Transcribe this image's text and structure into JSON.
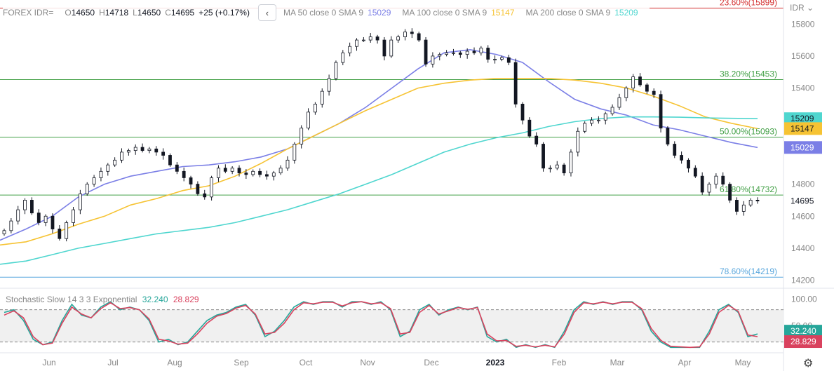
{
  "legend": {
    "symbol": "FOREX IDR=",
    "open_label": "O",
    "open": "14650",
    "high_label": "H",
    "high": "14718",
    "low_label": "L",
    "low": "14650",
    "close_label": "C",
    "close": "14695",
    "change": "+25 (+0.17%)",
    "ma50_label": "MA 50 close 0 SMA 9",
    "ma50_value": "15029",
    "ma100_label": "MA 100 close 0 SMA 9",
    "ma100_value": "15147",
    "ma200_label": "MA 200 close 0 SMA 9",
    "ma200_value": "15209"
  },
  "currency_label": "IDR",
  "stochastic": {
    "label": "Stochastic Slow 14 3 3 Exponential",
    "k_value": "32.240",
    "d_value": "28.829"
  },
  "colors": {
    "ma50": "#7b7fe6",
    "ma100": "#f6c333",
    "ma200": "#4fd6cf",
    "stoch_k": "#26a69a",
    "stoch_d": "#d9425e",
    "fib_red": "#d32f2f",
    "fib_green": "#43a047",
    "fib_blue": "#5aa7dd"
  },
  "chart_data": [
    {
      "type": "candlestick",
      "title": "FOREX IDR=",
      "y_unit": "IDR",
      "ylim": [
        14150,
        15950
      ],
      "y_ticks": [
        14200,
        14400,
        14600,
        14800,
        15400,
        15600,
        15800
      ],
      "x_ticks": [
        "Jun",
        "Jul",
        "Aug",
        "Sep",
        "Oct",
        "Nov",
        "Dec",
        "2023",
        "Feb",
        "Mar",
        "Apr",
        "May"
      ],
      "last_price": 14695,
      "fib_levels": [
        {
          "label": "23.60%(15899)",
          "value": 15899,
          "color": "red"
        },
        {
          "label": "38.20%(15453)",
          "value": 15453,
          "color": "green"
        },
        {
          "label": "50.00%(15093)",
          "value": 15093,
          "color": "green"
        },
        {
          "label": "61.80%(14732)",
          "value": 14732,
          "color": "green"
        },
        {
          "label": "78.60%(14219)",
          "value": 14219,
          "color": "blue"
        }
      ],
      "close_series": [
        14510,
        14570,
        14640,
        14700,
        14620,
        14560,
        14600,
        14520,
        14460,
        14560,
        14640,
        14740,
        14800,
        14840,
        14880,
        14920,
        14950,
        15000,
        15010,
        15030,
        15010,
        15020,
        15000,
        14980,
        14920,
        14880,
        14840,
        14800,
        14740,
        14720,
        14840,
        14900,
        14880,
        14900,
        14870,
        14860,
        14880,
        14860,
        14850,
        14870,
        14900,
        14950,
        15050,
        15150,
        15250,
        15300,
        15380,
        15460,
        15560,
        15620,
        15660,
        15700,
        15700,
        15720,
        15700,
        15600,
        15700,
        15720,
        15750,
        15740,
        15700,
        15550,
        15600,
        15610,
        15620,
        15620,
        15610,
        15630,
        15620,
        15650,
        15580,
        15580,
        15590,
        15560,
        15300,
        15200,
        15100,
        15050,
        14900,
        14900,
        14920,
        14870,
        15000,
        15130,
        15180,
        15200,
        15200,
        15240,
        15280,
        15340,
        15400,
        15470,
        15420,
        15380,
        15360,
        15150,
        15050,
        14980,
        14950,
        14900,
        14850,
        14750,
        14800,
        14850,
        14800,
        14700,
        14630,
        14670,
        14700,
        14695
      ],
      "series": [
        {
          "name": "MA 50",
          "value": 15029,
          "points": [
            14450,
            14520,
            14600,
            14720,
            14800,
            14850,
            14880,
            14910,
            14920,
            14940,
            14970,
            15020,
            15100,
            15180,
            15280,
            15400,
            15520,
            15620,
            15640,
            15610,
            15560,
            15440,
            15330,
            15270,
            15230,
            15170,
            15140,
            15100,
            15060,
            15029
          ]
        },
        {
          "name": "MA 100",
          "value": 15147,
          "points": [
            14420,
            14440,
            14490,
            14550,
            14600,
            14670,
            14710,
            14760,
            14790,
            14850,
            14930,
            15020,
            15100,
            15180,
            15260,
            15330,
            15400,
            15430,
            15450,
            15460,
            15460,
            15460,
            15450,
            15430,
            15400,
            15350,
            15290,
            15220,
            15180,
            15147
          ]
        },
        {
          "name": "MA 200",
          "value": 15209,
          "points": [
            14300,
            14320,
            14360,
            14400,
            14430,
            14460,
            14490,
            14510,
            14530,
            14560,
            14600,
            14640,
            14690,
            14740,
            14800,
            14860,
            14930,
            15000,
            15050,
            15090,
            15120,
            15160,
            15190,
            15210,
            15220,
            15220,
            15218,
            15214,
            15211,
            15209
          ]
        }
      ]
    },
    {
      "type": "line",
      "title": "Stochastic Slow 14 3 3 Exponential",
      "ylim": [
        0,
        120
      ],
      "y_ticks": [
        100,
        50
      ],
      "bands": [
        80,
        20
      ],
      "series": [
        {
          "name": "%K",
          "value": 32.24,
          "points": [
            75,
            80,
            60,
            25,
            15,
            20,
            60,
            90,
            70,
            65,
            85,
            95,
            80,
            85,
            80,
            60,
            20,
            25,
            15,
            20,
            40,
            60,
            70,
            75,
            85,
            90,
            70,
            30,
            40,
            60,
            85,
            95,
            90,
            95,
            95,
            85,
            95,
            95,
            90,
            95,
            80,
            30,
            40,
            80,
            90,
            70,
            80,
            85,
            80,
            85,
            30,
            20,
            25,
            10,
            15,
            10,
            15,
            10,
            40,
            80,
            95,
            90,
            95,
            90,
            95,
            95,
            80,
            40,
            20,
            10,
            10,
            10,
            10,
            40,
            80,
            90,
            75,
            30,
            35
          ]
        },
        {
          "name": "%D",
          "value": 28.829,
          "points": [
            70,
            78,
            65,
            30,
            15,
            18,
            55,
            85,
            72,
            65,
            82,
            93,
            82,
            84,
            80,
            63,
            25,
            22,
            16,
            18,
            35,
            55,
            68,
            73,
            83,
            88,
            72,
            35,
            38,
            55,
            80,
            93,
            91,
            94,
            94,
            87,
            93,
            95,
            91,
            93,
            82,
            35,
            38,
            75,
            88,
            72,
            78,
            84,
            81,
            84,
            35,
            22,
            23,
            12,
            14,
            11,
            14,
            11,
            35,
            75,
            93,
            91,
            94,
            91,
            94,
            94,
            82,
            45,
            23,
            12,
            11,
            10,
            11,
            35,
            75,
            88,
            77,
            33,
            30
          ]
        }
      ]
    }
  ]
}
